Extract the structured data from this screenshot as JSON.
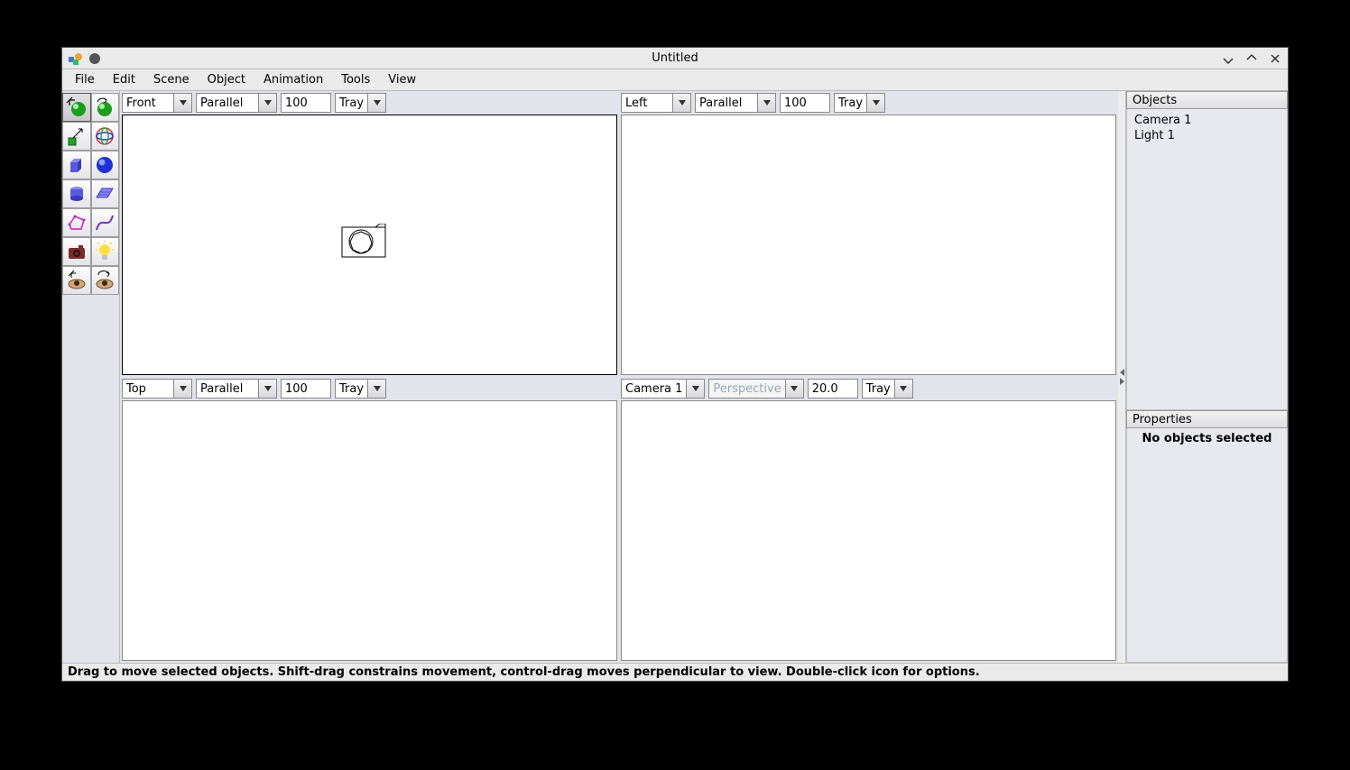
{
  "window": {
    "title": "Untitled"
  },
  "menu": {
    "items": [
      "File",
      "Edit",
      "Scene",
      "Object",
      "Animation",
      "Tools",
      "View"
    ]
  },
  "viewports": [
    {
      "view": "Front",
      "projection": "Parallel",
      "zoom": "100",
      "tray": "Tray",
      "projection_disabled": false
    },
    {
      "view": "Left",
      "projection": "Parallel",
      "zoom": "100",
      "tray": "Tray",
      "projection_disabled": false
    },
    {
      "view": "Top",
      "projection": "Parallel",
      "zoom": "100",
      "tray": "Tray",
      "projection_disabled": false
    },
    {
      "view": "Camera 1",
      "projection": "Perspective",
      "zoom": "20.0",
      "tray": "Tray",
      "projection_disabled": true
    }
  ],
  "objects_panel": {
    "header": "Objects",
    "items": [
      "Camera 1",
      "Light 1"
    ]
  },
  "properties_panel": {
    "header": "Properties",
    "message": "No objects selected"
  },
  "statusbar": {
    "text": "Drag to move selected objects.  Shift-drag constrains movement, control-drag moves perpendicular to view.  Double-click icon for options."
  },
  "tools": [
    [
      "move-object",
      "rotate-object"
    ],
    [
      "scale-object",
      "universal-manip"
    ],
    [
      "create-cube",
      "create-sphere"
    ],
    [
      "create-cylinder",
      "create-plane"
    ],
    [
      "create-spline",
      "create-curve"
    ],
    [
      "create-camera",
      "create-light"
    ],
    [
      "pan-view",
      "orbit-view"
    ]
  ]
}
